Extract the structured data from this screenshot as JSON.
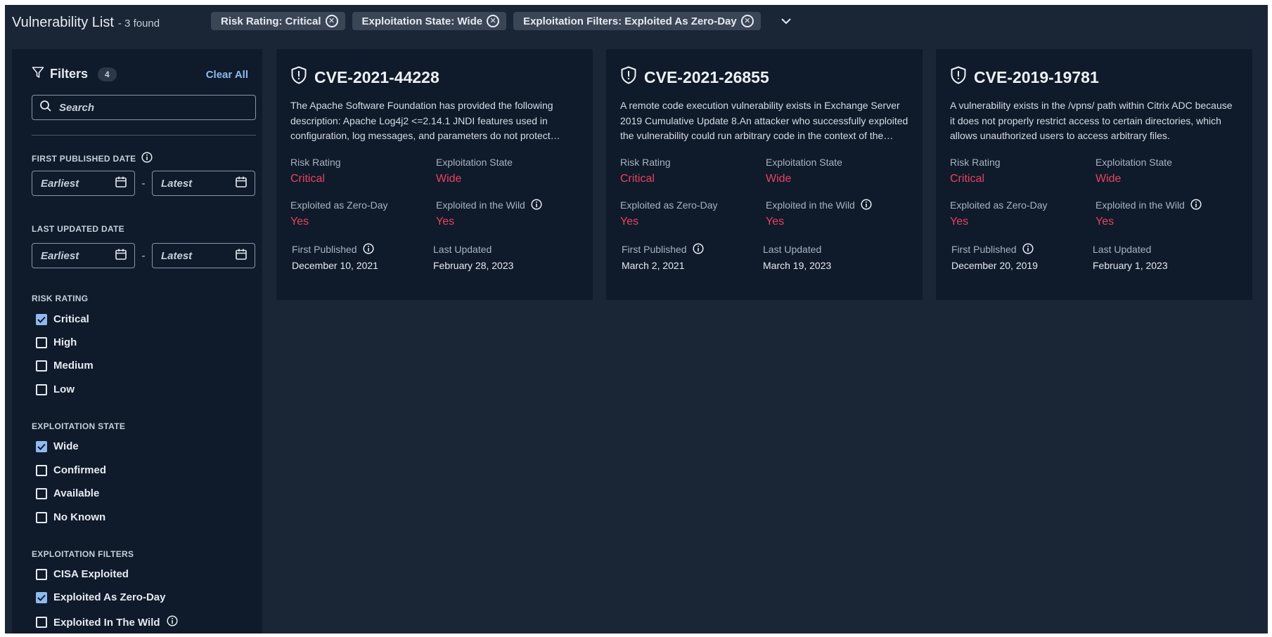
{
  "header": {
    "title": "Vulnerability List",
    "count": "- 3 found",
    "chips": [
      {
        "label": "Risk Rating: Critical"
      },
      {
        "label": "Exploitation State: Wide"
      },
      {
        "label": "Exploitation Filters: Exploited As Zero-Day"
      }
    ]
  },
  "sidebar": {
    "filters_label": "Filters",
    "filters_count": "4",
    "clear_all": "Clear All",
    "search_placeholder": "Search",
    "first_published": {
      "title": "FIRST PUBLISHED DATE",
      "earliest": "Earliest",
      "latest": "Latest"
    },
    "last_updated": {
      "title": "LAST UPDATED DATE",
      "earliest": "Earliest",
      "latest": "Latest"
    },
    "date_separator": "-",
    "risk_rating": {
      "title": "RISK RATING",
      "options": [
        {
          "label": "Critical",
          "checked": true
        },
        {
          "label": "High",
          "checked": false
        },
        {
          "label": "Medium",
          "checked": false
        },
        {
          "label": "Low",
          "checked": false
        }
      ]
    },
    "exploitation_state": {
      "title": "EXPLOITATION STATE",
      "options": [
        {
          "label": "Wide",
          "checked": true
        },
        {
          "label": "Confirmed",
          "checked": false
        },
        {
          "label": "Available",
          "checked": false
        },
        {
          "label": "No Known",
          "checked": false
        }
      ]
    },
    "exploitation_filters": {
      "title": "EXPLOITATION FILTERS",
      "options": [
        {
          "label": "CISA Exploited",
          "checked": false
        },
        {
          "label": "Exploited As Zero-Day",
          "checked": true
        },
        {
          "label": "Exploited In The Wild",
          "checked": false
        }
      ]
    }
  },
  "labels": {
    "risk_rating": "Risk Rating",
    "exploitation_state": "Exploitation State",
    "zero_day": "Exploited as Zero-Day",
    "in_the_wild": "Exploited in the Wild",
    "first_published": "First Published",
    "last_updated": "Last Updated"
  },
  "cards": [
    {
      "id": "CVE-2021-44228",
      "description": "The Apache Software Foundation has provided the following description: Apache Log4j2 <=2.14.1 JNDI features used in configuration, log messages, and parameters do not protect against attacker controlled LDAP and other JNDI related endpoints.",
      "risk_rating": "Critical",
      "exploitation_state": "Wide",
      "zero_day": "Yes",
      "in_the_wild": "Yes",
      "first_published": "December 10, 2021",
      "last_updated": "February 28, 2023"
    },
    {
      "id": "CVE-2021-26855",
      "description": "A remote code execution vulnerability exists in Exchange Server 2019 Cumulative Update 8.An attacker who successfully exploited the vulnerability could run arbitrary code in the context of the System user.",
      "risk_rating": "Critical",
      "exploitation_state": "Wide",
      "zero_day": "Yes",
      "in_the_wild": "Yes",
      "first_published": "March 2, 2021",
      "last_updated": "March 19, 2023"
    },
    {
      "id": "CVE-2019-19781",
      "description": "A vulnerability exists in the /vpns/ path within Citrix ADC because it does not properly restrict access to certain directories, which allows unauthorized users to access arbitrary files.",
      "risk_rating": "Critical",
      "exploitation_state": "Wide",
      "zero_day": "Yes",
      "in_the_wild": "Yes",
      "first_published": "December 20, 2019",
      "last_updated": "February 1, 2023"
    }
  ],
  "colors": {
    "background": "#1a2535",
    "panel": "#0f1a2a",
    "accent": "#8fbaf0",
    "critical": "#e6445e"
  }
}
